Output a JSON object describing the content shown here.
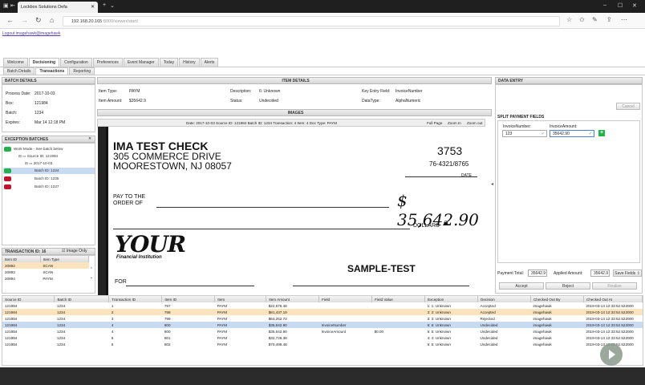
{
  "browser": {
    "tab_title": "Lockbox Solutions Defa",
    "url_host": "192.168.20.165",
    "url_path": ":8000/viewer/start/"
  },
  "logout_text": "Logout imagehawk@imagehawk",
  "app_tabs": [
    "Welcome",
    "Decisioning",
    "Configuration",
    "Preferences",
    "Event Manager",
    "Today",
    "History",
    "Alerts"
  ],
  "sub_tabs": [
    "Batch Details",
    "Transactions",
    "Reporting"
  ],
  "batch_details": {
    "header": "BATCH DETAILS",
    "process_date_label": "Process Date:",
    "process_date": "2017-10-03",
    "box_label": "Box:",
    "box": "121984",
    "batch_label": "Batch:",
    "batch": "1234",
    "expires_label": "Expires:",
    "expires": "Mar 14 12:18 PM"
  },
  "exception_batches": {
    "header": "EXCEPTION BATCHES",
    "work_mode": "Work Mode - See batch below",
    "source": "Source ID: 121984",
    "date": "2017-10-03",
    "batches": [
      "Batch ID: 1234",
      "Batch ID: 1235",
      "Batch ID: 1237"
    ]
  },
  "transaction_panel": {
    "header": "TRANSACTION ID: 16",
    "image_only": "Image Only",
    "cols": [
      "Item ID",
      "Item Type"
    ],
    "rows": [
      [
        "20892",
        "SCAN"
      ],
      [
        "20893",
        "SCAN"
      ],
      [
        "20894",
        "PAYM"
      ]
    ]
  },
  "item_details": {
    "header": "ITEM DETAILS",
    "item_type_label": "Item Type:",
    "item_type": "PAYM",
    "item_amount_label": "Item Amount:",
    "item_amount": "$35642.9",
    "description_label": "Description:",
    "description": "6: Unknown",
    "status_label": "Status:",
    "status": "Undecided",
    "key_entry_label": "Key Entry Field:",
    "key_entry": "InvoiceNumber",
    "datatype_label": "DataType:",
    "datatype": "AlphaNumeric"
  },
  "images": {
    "header": "IMAGES",
    "info": "Date: 2017-10-03 Source ID: 121984 Batch ID: 1234 Transaction: 4 Item: 4 Doc Type: PAYM",
    "full_page": "Full Page",
    "zoom_in": "Zoom In",
    "zoom_out": "Zoom out"
  },
  "check": {
    "company": "IMA TEST CHECK",
    "address1": "305 COMMERCE DRIVE",
    "address2": "MOORESTOWN, NJ 08057",
    "number": "3753",
    "routing": "76-4321/8765",
    "date_label": "DATE",
    "pay_to1": "PAY TO THE",
    "pay_to2": "ORDER OF",
    "amount": "$ 35,642.90",
    "dollars": "DOLLARS",
    "bank1": "YOUR",
    "bank2": "Financial Institution",
    "sample": "SAMPLE-TEST",
    "for": "FOR"
  },
  "data_entry": {
    "header": "DATA ENTRY",
    "cancel": "Cancel",
    "split_title": "SPLIT PAYMENT FIELDS",
    "invoice_number_label": "InvoiceNumber:",
    "invoice_amount_label": "InvoiceAmount:",
    "invoice_number": "123",
    "invoice_amount": "35642.90",
    "payment_total_label": "Payment Total:",
    "payment_total": "35642.9",
    "applied_amount_label": "Applied Amount:",
    "applied_amount": "35642.9",
    "save_fields": "Save Fields",
    "accept": "Accept",
    "reject": "Reject",
    "finalize": "Finalize"
  },
  "grid": {
    "cols": [
      "Source ID",
      "Batch ID",
      "Transaction ID",
      "Item ID",
      "Item",
      "Item Amount",
      "Field",
      "Field Value",
      "Exception",
      "Decision",
      "Checked Out By",
      "Checked Out At"
    ],
    "rows": [
      [
        "121984",
        "1234",
        "1",
        "797",
        "PAYM",
        "$22,576.46",
        "",
        "",
        "1: 1: Unknown",
        "Accepted",
        "imagehawk",
        "2019-03-13 12:33:52.522000"
      ],
      [
        "121984",
        "1234",
        "2",
        "798",
        "PAYM",
        "$81,437.19",
        "",
        "",
        "2: 2: Unknown",
        "Accepted",
        "imagehawk",
        "2019-03-13 12:33:52.522000"
      ],
      [
        "121984",
        "1234",
        "3",
        "799",
        "PAYM",
        "$64,252.73",
        "",
        "",
        "3: 3: Unknown",
        "Rejected",
        "imagehawk",
        "2019-03-13 12:33:52.522000"
      ],
      [
        "121984",
        "1234",
        "4",
        "800",
        "PAYM",
        "$35,642.90",
        "InvoiceNumber",
        "",
        "6: 6: Unknown",
        "Undecided",
        "imagehawk",
        "2019-03-13 12:33:52.522000"
      ],
      [
        "121984",
        "1234",
        "4",
        "800",
        "PAYM",
        "$35,642.90",
        "InvoiceAmount",
        "$0.00",
        "5: 5: Unknown",
        "Undecided",
        "imagehawk",
        "2019-03-13 12:33:52.522000"
      ],
      [
        "121984",
        "1234",
        "5",
        "801",
        "PAYM",
        "$32,726.38",
        "",
        "",
        "4: 4: Unknown",
        "Undecided",
        "imagehawk",
        "2019-03-13 12:33:52.522000"
      ],
      [
        "121984",
        "1234",
        "6",
        "802",
        "PAYM",
        "$70,499.48",
        "",
        "",
        "5: 5: Unknown",
        "Undecided",
        "imagehawk",
        "2019-03-13 12:33:52.522000"
      ]
    ],
    "row_colors": [
      "#ffffff",
      "#fbe3bd",
      "#ffffff",
      "#c9daf3",
      "#ffffff",
      "#ffffff",
      "#ffffff"
    ]
  },
  "colors": {
    "accent_blue": "#c9daf3",
    "highlight_orange": "#fbe3bd",
    "green": "#22b14c",
    "red": "#c0142a"
  }
}
